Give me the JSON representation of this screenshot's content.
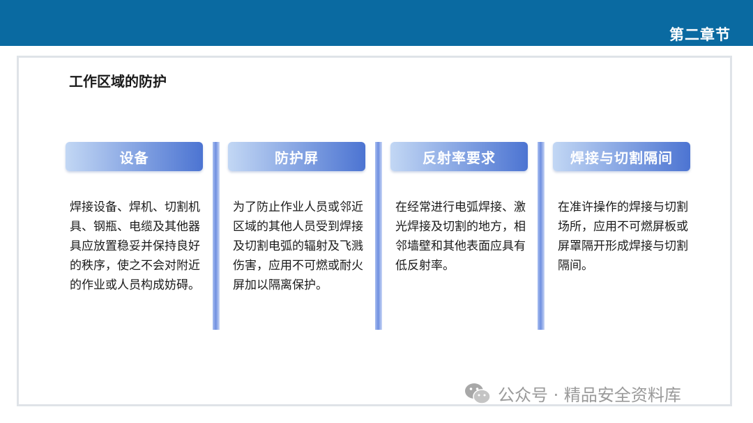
{
  "header": {
    "chapter": "第二章节"
  },
  "page": {
    "title": "工作区域的防护"
  },
  "columns": [
    {
      "title": "设备",
      "body": "焊接设备、焊机、切割机具、钢瓶、电缆及其他器具应放置稳妥并保持良好的秩序，使之不会对附近的作业或人员构成妨碍。"
    },
    {
      "title": "防护屏",
      "body": "为了防止作业人员或邻近区域的其他人员受到焊接及切割电弧的辐射及飞溅伤害，应用不可燃或耐火屏加以隔离保护。"
    },
    {
      "title": "反射率要求",
      "body": "在经常进行电弧焊接、激光焊接及切割的地方，相邻墙壁和其他表面应具有低反射率。"
    },
    {
      "title": "焊接与切割隔间",
      "body": "在准许操作的焊接与切割场所，应用不可燃屏板或屏罩隔开形成焊接与切割隔间。"
    }
  ],
  "watermark": {
    "text": "公众号 · 精品安全资料库",
    "icon": "wechat-icon"
  },
  "colors": {
    "top_bar": "#0a6aa1",
    "header_gradient_start": "#c2d7f4",
    "header_gradient_end": "#4c74d2"
  }
}
